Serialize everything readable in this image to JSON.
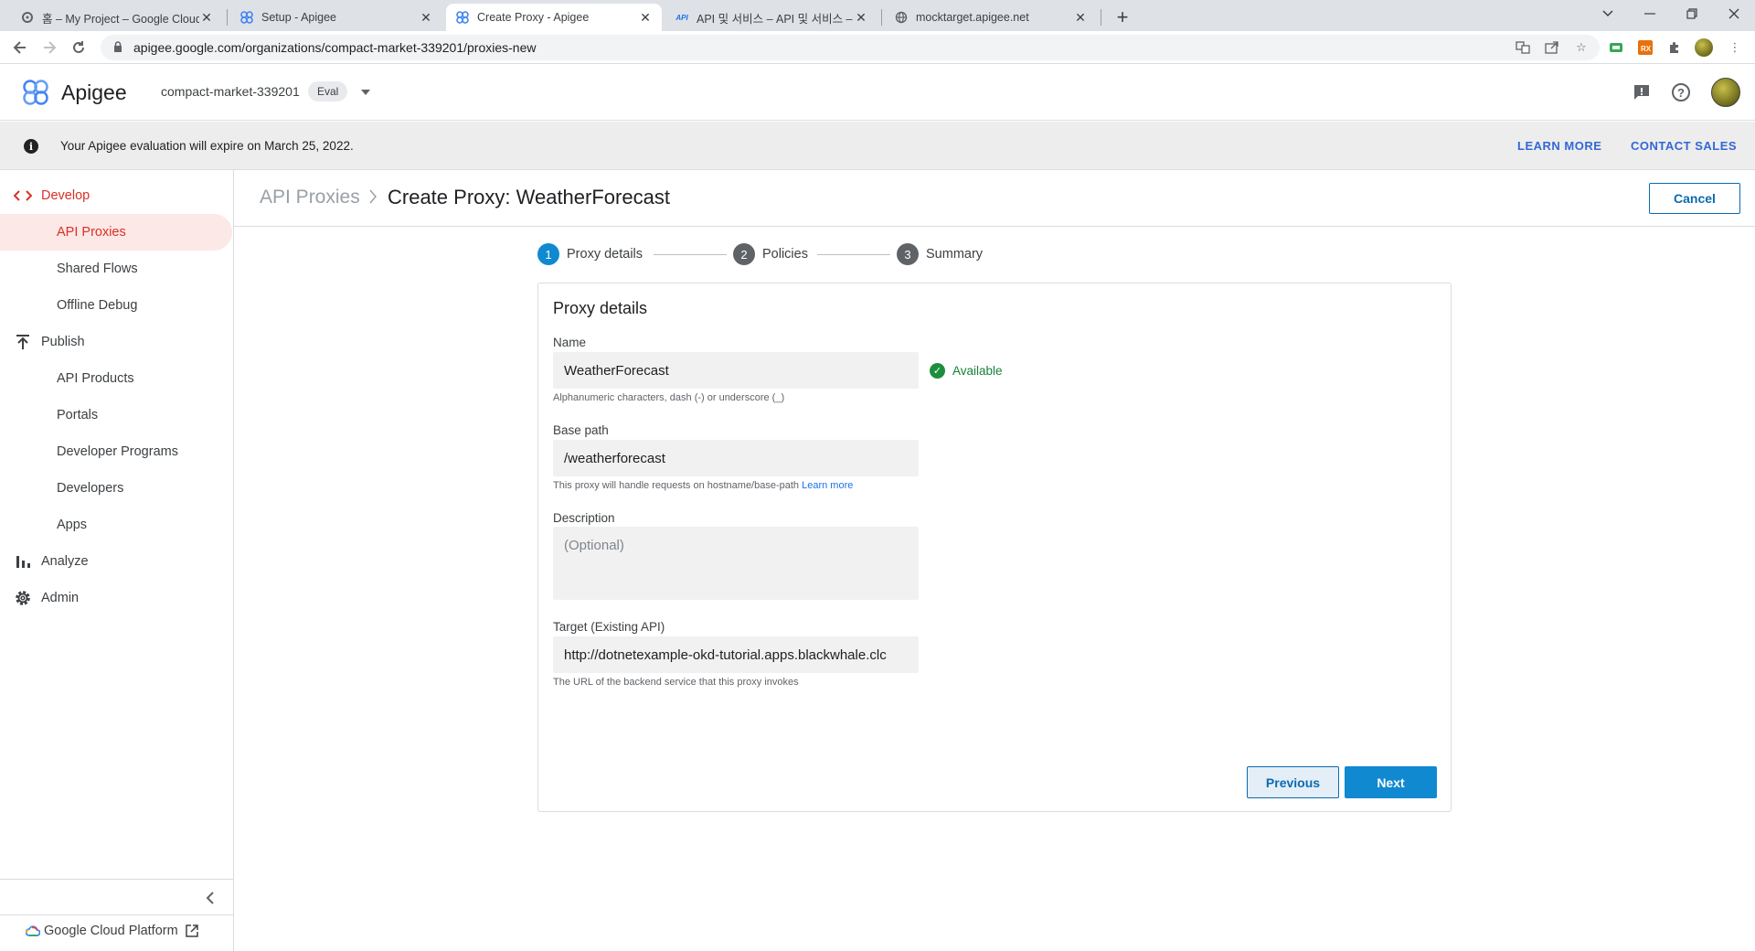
{
  "browser": {
    "tabs": [
      {
        "title": "홈 – My Project – Google Cloud",
        "icon": "gear-icon"
      },
      {
        "title": "Setup - Apigee",
        "icon": "apigee-icon"
      },
      {
        "title": "Create Proxy - Apigee",
        "icon": "apigee-icon"
      },
      {
        "title": "API 및 서비스 – API 및 서비스 –",
        "icon": "api-icon"
      },
      {
        "title": "mocktarget.apigee.net",
        "icon": "globe-icon"
      }
    ],
    "url": "apigee.google.com/organizations/compact-market-339201/proxies-new"
  },
  "header": {
    "app_name": "Apigee",
    "org": "compact-market-339201",
    "org_badge": "Eval"
  },
  "banner": {
    "message": "Your Apigee evaluation will expire on March 25, 2022.",
    "learn_more": "LEARN MORE",
    "contact_sales": "CONTACT SALES"
  },
  "sidebar": {
    "develop": "Develop",
    "api_proxies": "API Proxies",
    "shared_flows": "Shared Flows",
    "offline_debug": "Offline Debug",
    "publish": "Publish",
    "api_products": "API Products",
    "portals": "Portals",
    "developer_programs": "Developer Programs",
    "developers": "Developers",
    "apps": "Apps",
    "analyze": "Analyze",
    "admin": "Admin",
    "gcp": "Google Cloud Platform"
  },
  "page": {
    "breadcrumb": "API Proxies",
    "title": "Create Proxy: WeatherForecast",
    "cancel": "Cancel"
  },
  "stepper": [
    {
      "num": "1",
      "label": "Proxy details"
    },
    {
      "num": "2",
      "label": "Policies"
    },
    {
      "num": "3",
      "label": "Summary"
    }
  ],
  "form": {
    "title": "Proxy details",
    "name_label": "Name",
    "name_value": "WeatherForecast",
    "name_status": "Available",
    "name_hint": "Alphanumeric characters, dash (-) or underscore (_)",
    "basepath_label": "Base path",
    "basepath_value": "/weatherforecast",
    "basepath_hint": "This proxy will handle requests on hostname/base-path",
    "basepath_hint_link": "Learn more",
    "description_label": "Description",
    "description_placeholder": "(Optional)",
    "target_label": "Target (Existing API)",
    "target_value": "http://dotnetexample-okd-tutorial.apps.blackwhale.clc",
    "target_hint": "The URL of the backend service that this proxy invokes",
    "previous": "Previous",
    "next": "Next"
  },
  "colors": {
    "accent": "#1089d0",
    "active_nav": "#d93025",
    "available": "#188038"
  }
}
